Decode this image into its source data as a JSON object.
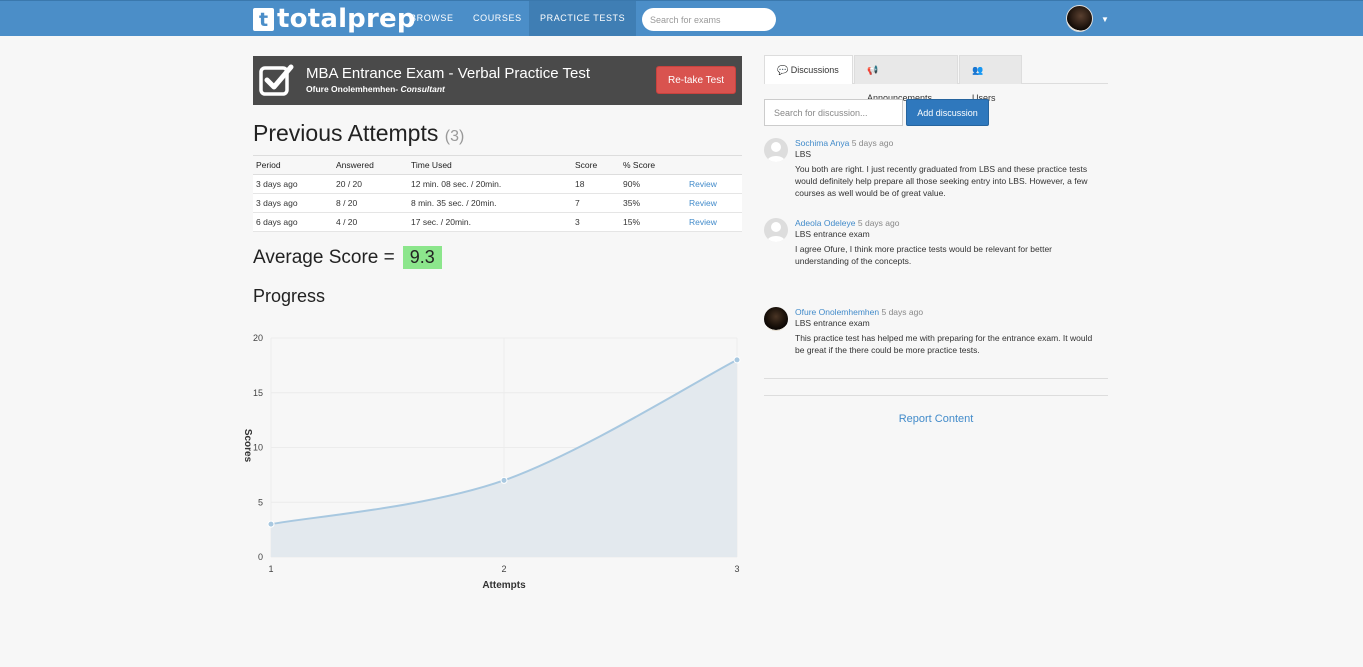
{
  "nav": {
    "logo_letter": "t",
    "logo_text": "totalprep",
    "items": [
      {
        "label": "BROWSE"
      },
      {
        "label": "COURSES"
      },
      {
        "label": "PRACTICE TESTS"
      }
    ],
    "search_placeholder": "Search for exams"
  },
  "exam": {
    "title": "MBA Entrance Exam - Verbal Practice Test",
    "author": "Ofure Onolemhemhen",
    "role": "Consultant",
    "retake_label": "Re-take Test"
  },
  "attempts": {
    "title": "Previous Attempts",
    "count": "(3)",
    "headers": [
      "Period",
      "Answered",
      "Time Used",
      "Score",
      "% Score"
    ],
    "rows": [
      {
        "period": "3 days ago",
        "answered": "20 / 20",
        "time": "12 min. 08 sec. / 20min.",
        "score": "18",
        "pct": "90%",
        "review": "Review"
      },
      {
        "period": "3 days ago",
        "answered": "8 / 20",
        "time": "8 min. 35 sec. / 20min.",
        "score": "7",
        "pct": "35%",
        "review": "Review"
      },
      {
        "period": "6 days ago",
        "answered": "4 / 20",
        "time": "17 sec. / 20min.",
        "score": "3",
        "pct": "15%",
        "review": "Review"
      }
    ]
  },
  "average": {
    "label": "Average Score =",
    "value": "9.3",
    "highlight_color": "#8ce68c"
  },
  "progress_title": "Progress",
  "chart_data": {
    "type": "area",
    "x": [
      1,
      2,
      3
    ],
    "values": [
      3,
      7,
      18
    ],
    "xlabel": "Attempts",
    "ylabel": "Scores",
    "ylim": [
      0,
      20
    ],
    "yticks": [
      0,
      5,
      10,
      15,
      20
    ],
    "xticks": [
      1,
      2,
      3
    ],
    "grid": true,
    "line_color": "#a8c8e0",
    "fill_color": "#e3e9ee"
  },
  "tabs": [
    {
      "label": "Discussions",
      "icon": "comments-icon"
    },
    {
      "label": "Announcements",
      "icon": "bullhorn-icon"
    },
    {
      "label": "Users",
      "icon": "users-icon"
    }
  ],
  "discussion": {
    "search_placeholder": "Search for discussion...",
    "add_label": "Add discussion",
    "posts": [
      {
        "author": "Sochima Anya",
        "time": "5 days ago",
        "subject": "LBS",
        "text": "You both are right. I just recently graduated from LBS and these practice tests would definitely help prepare all those seeking entry into LBS. However, a few courses as well would be of great value."
      },
      {
        "author": "Adeola Odeleye",
        "time": "5 days ago",
        "subject": "LBS entrance exam",
        "text": "I agree Ofure, I think more practice tests would be relevant for better understanding of the concepts."
      },
      {
        "author": "Ofure Onolemhemhen",
        "time": "5 days ago",
        "subject": "LBS entrance exam",
        "text": "This practice test has helped me with preparing for the entrance exam. It would be great if the there could be more practice tests."
      }
    ],
    "report_label": "Report Content"
  },
  "colors": {
    "brand": "#4b8ec8",
    "danger": "#d9534f",
    "primary": "#2f78bd",
    "link": "#428bca"
  }
}
